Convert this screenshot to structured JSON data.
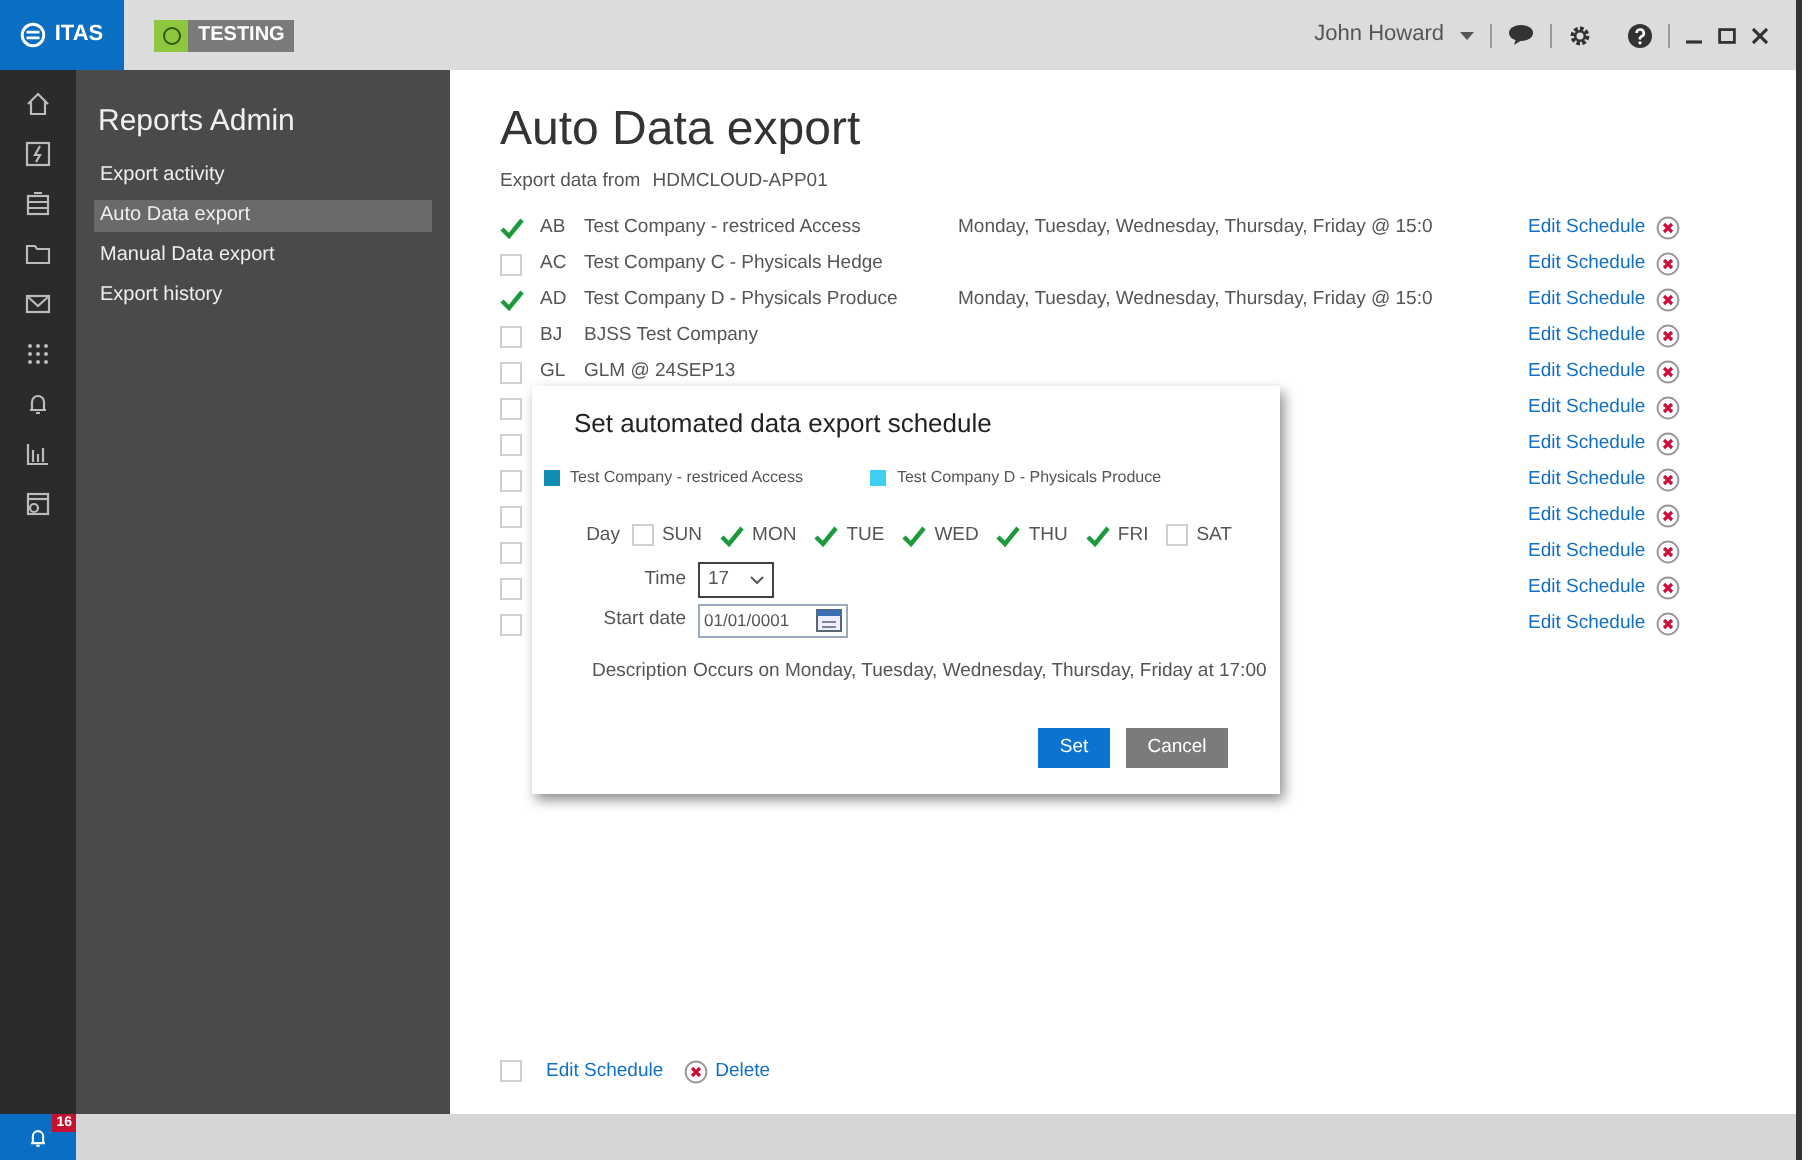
{
  "app": {
    "logo": "ITAS",
    "environment": "TESTING"
  },
  "user": {
    "name": "John Howard"
  },
  "sidebar": {
    "title": "Reports Admin",
    "items": [
      {
        "label": "Export activity",
        "selected": false
      },
      {
        "label": "Auto Data export",
        "selected": true
      },
      {
        "label": "Manual Data export",
        "selected": false
      },
      {
        "label": "Export history",
        "selected": false
      }
    ]
  },
  "page": {
    "title": "Auto Data export",
    "source_label": "Export data from",
    "source": "HDMCLOUD-APP01"
  },
  "rows": [
    {
      "checked": true,
      "code": "AB",
      "name": "Test Company - restriced Access",
      "schedule": "Monday, Tuesday, Wednesday, Thursday, Friday @ 15:0",
      "action": "Edit Schedule"
    },
    {
      "checked": false,
      "code": "AC",
      "name": "Test Company C - Physicals Hedge",
      "action": "Edit Schedule"
    },
    {
      "checked": true,
      "code": "AD",
      "name": "Test Company D - Physicals Produce",
      "schedule": "Monday, Tuesday, Wednesday, Thursday, Friday @ 15:0",
      "action": "Edit Schedule"
    },
    {
      "checked": false,
      "code": "BJ",
      "name": "BJSS Test Company",
      "action": "Edit Schedule"
    },
    {
      "checked": false,
      "code": "GL",
      "name": "GLM @ 24SEP13",
      "action": "Edit Schedule"
    },
    {
      "checked": false,
      "action": "Edit Schedule"
    },
    {
      "checked": false,
      "action": "Edit Schedule"
    },
    {
      "checked": false,
      "action": "Edit Schedule"
    },
    {
      "checked": false,
      "action": "Edit Schedule"
    },
    {
      "checked": false,
      "action": "Edit Schedule"
    },
    {
      "checked": false,
      "action": "Edit Schedule"
    },
    {
      "checked": false,
      "action": "Edit Schedule"
    }
  ],
  "footer": {
    "checked": false,
    "edit": "Edit Schedule",
    "delete": "Delete"
  },
  "dialog": {
    "title": "Set automated data export schedule",
    "legend": [
      {
        "label": "Test Company - restriced Access",
        "color": "#0f8db3"
      },
      {
        "label": "Test Company D - Physicals Produce",
        "color": "#3ecff0"
      }
    ],
    "day_label": "Day",
    "days": [
      {
        "label": "SUN",
        "checked": false
      },
      {
        "label": "MON",
        "checked": true
      },
      {
        "label": "TUE",
        "checked": true
      },
      {
        "label": "WED",
        "checked": true
      },
      {
        "label": "THU",
        "checked": true
      },
      {
        "label": "FRI",
        "checked": true
      },
      {
        "label": "SAT",
        "checked": false
      }
    ],
    "time_label": "Time",
    "time": "17",
    "start_label": "Start date",
    "start": "01/01/0001",
    "description_label": "Description",
    "description": "Occurs on Monday, Tuesday, Wednesday, Thursday, Friday at 17:00",
    "buttons": [
      "Set",
      "Cancel"
    ]
  },
  "notifications": {
    "count": "16"
  }
}
